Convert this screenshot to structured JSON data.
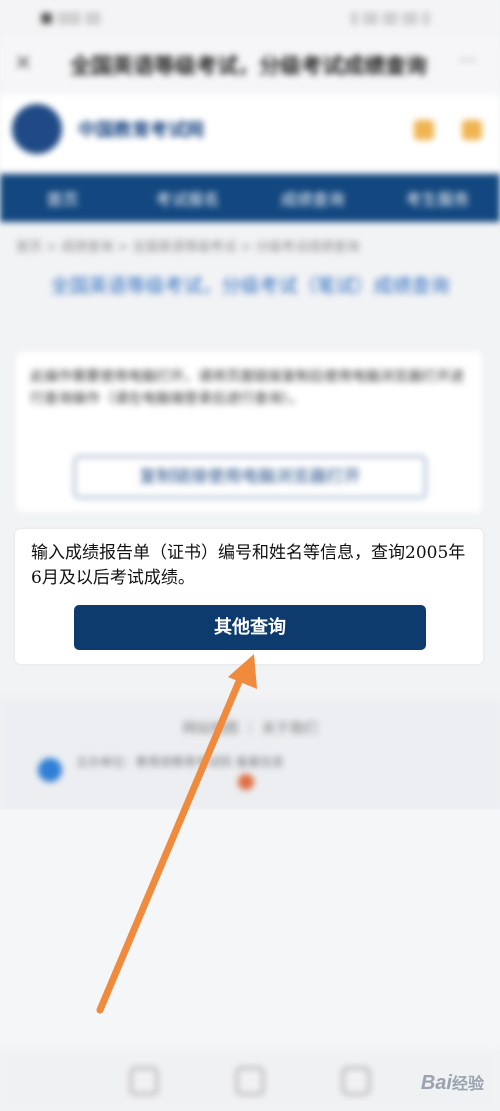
{
  "status_bar": {
    "left": "■ ▯▯▯ ▯▯",
    "right": "▯ ▯▯ ▯▯ ▯▯ ▯"
  },
  "browser": {
    "close_icon": "×",
    "title": "全国英语等级考试，分级考试成绩查询",
    "more_icon": "···"
  },
  "site": {
    "logo_text": "中国教育考试网"
  },
  "nav": {
    "items": [
      "首页",
      "考试报名",
      "成绩查询",
      "考生服务"
    ]
  },
  "breadcrumb": "首页 > 成绩查询 > 全国英语等级考试 > 分级考试成绩查询",
  "page_heading": "全国英语等级考试，分级考试（笔试）成绩查询",
  "notice_card": {
    "text": "此操作需要使用电脑打开，请将页面链接复制后使用电脑浏览器打开进行查询操作（请在电脑端登录后进行查询）。",
    "copy_button": "复制链接使用电脑浏览器打开"
  },
  "query_card": {
    "description": "输入成绩报告单（证书）编号和姓名等信息，查询2005年6月及以后考试成绩。",
    "button": "其他查询"
  },
  "footer": {
    "links": "网站地图 ｜ 关于我们",
    "info": "主办单位：教育部教育考试院 备案信息"
  },
  "watermark": {
    "brand": "Bai",
    "sub": "经验"
  },
  "colors": {
    "nav_bg": "#12477f",
    "button_bg": "#0d3b6e",
    "arrow": "#f08a3c"
  }
}
